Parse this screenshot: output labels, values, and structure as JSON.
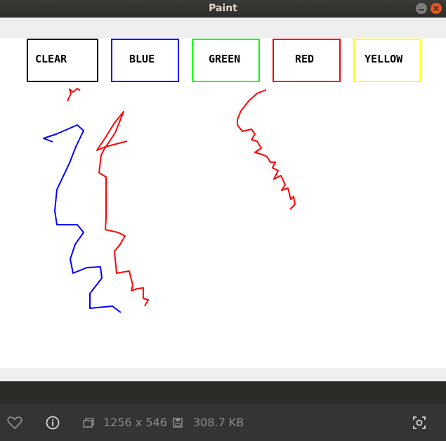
{
  "window": {
    "title": "Paint"
  },
  "palette": [
    {
      "label": "CLEAR",
      "color": "#000000"
    },
    {
      "label": "BLUE",
      "color": "#0000ff"
    },
    {
      "label": "GREEN",
      "color": "#00ff00"
    },
    {
      "label": "RED",
      "color": "#ff0000"
    },
    {
      "label": "YELLOW",
      "color": "#ffff00"
    }
  ],
  "strokes": [
    {
      "color": "#ff0000"
    },
    {
      "color": "#0000ff"
    },
    {
      "color": "#ff0000"
    },
    {
      "color": "#ff0000"
    }
  ],
  "status": {
    "dimensions": "1256 x 546",
    "file_size": "308.7 KB",
    "icons": [
      "heart-icon",
      "info-icon",
      "dimensions-icon",
      "file-size-icon",
      "screenshot-icon"
    ]
  }
}
